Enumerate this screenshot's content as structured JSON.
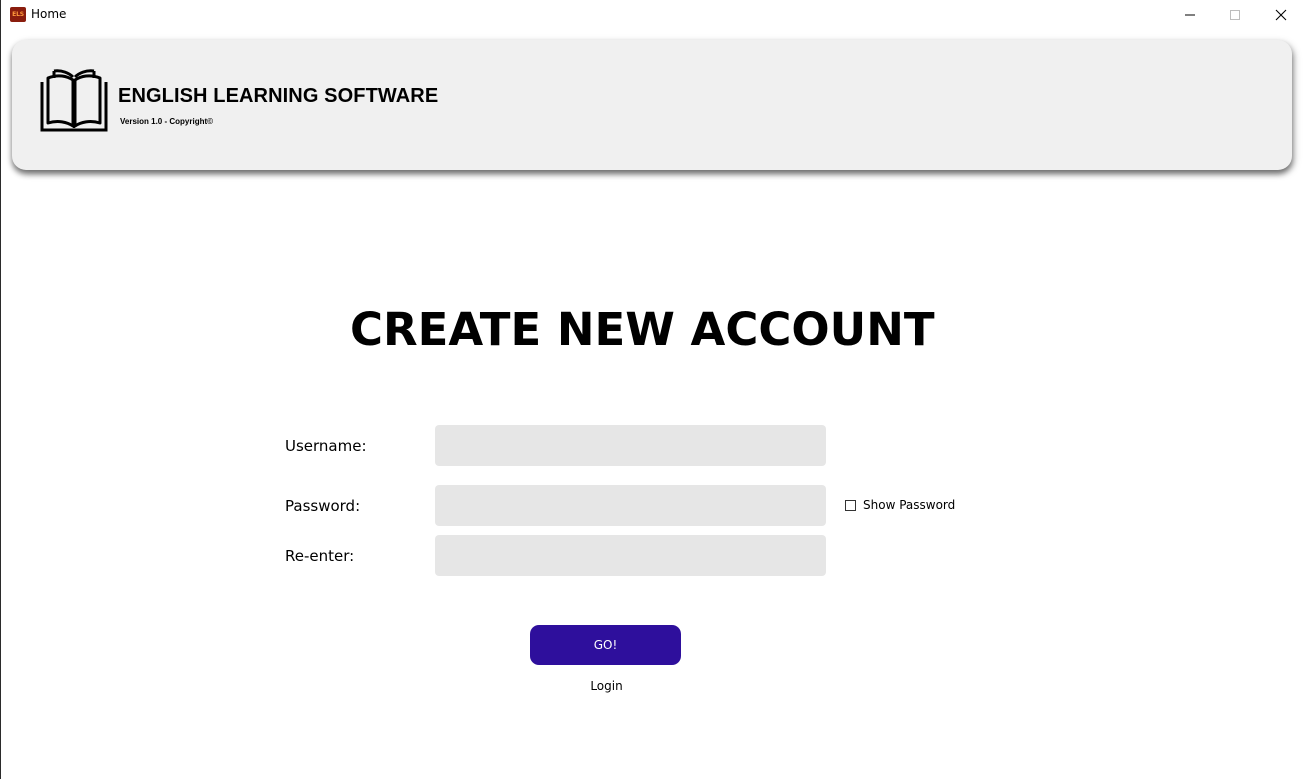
{
  "window": {
    "title": "Home",
    "icon": {
      "name": "els-app-icon",
      "text": "ELS",
      "color": "#8a1d0e"
    },
    "controls": {
      "minimize": "minimize-icon",
      "maximize": "maximize-icon",
      "close": "close-icon"
    }
  },
  "header": {
    "app_name": "ENGLISH LEARNING SOFTWARE",
    "version": "Version 1.0 - Copyright©",
    "logo_icon": "open-book-icon"
  },
  "form": {
    "title": "CREATE NEW ACCOUNT",
    "username_label": "Username:",
    "username_value": "",
    "password_label": "Password:",
    "password_value": "",
    "reenter_label": "Re-enter:",
    "reenter_value": "",
    "show_password_label": "Show Password",
    "show_password_checked": false,
    "submit_label": "GO!",
    "login_link": "Login"
  },
  "colors": {
    "accent": "#2e0f9c",
    "header_bg": "#f0f0f0",
    "input_bg": "#e6e6e6"
  }
}
